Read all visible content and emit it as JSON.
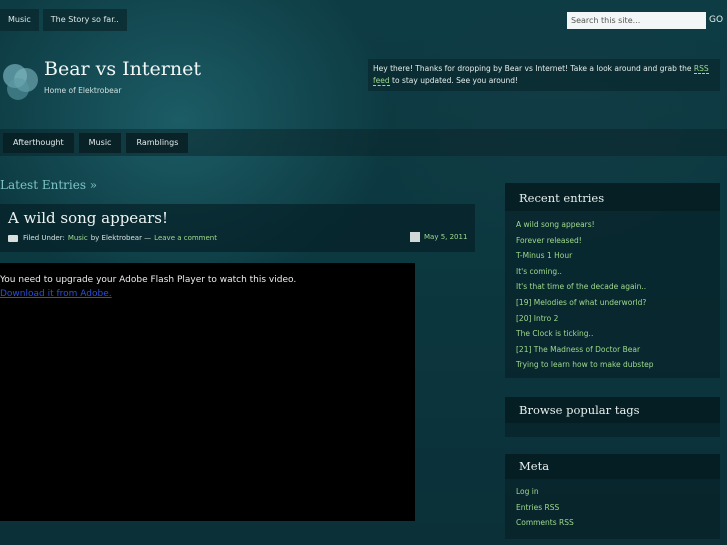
{
  "topnav": [
    "Music",
    "The Story so far.."
  ],
  "search": {
    "placeholder": "Search this site...",
    "go": "GO"
  },
  "site": {
    "title": "Bear vs Internet",
    "tagline": "Home of Elektrobear"
  },
  "welcome": {
    "text_before": "Hey there! Thanks for dropping by Bear vs Internet! Take a look around and grab the ",
    "rss_link": "RSS feed",
    "text_after": " to stay updated. See you around!"
  },
  "catnav": [
    "Afterthought",
    "Music",
    "Ramblings"
  ],
  "latest": "Latest Entries »",
  "post": {
    "title": "A wild song appears!",
    "filed_under": "Filed Under:",
    "category": "Music",
    "by": "by Elektrobear —",
    "comment": "Leave a comment",
    "date": "May 5, 2011",
    "flash_message": "You need to upgrade your Adobe Flash Player to watch this video.",
    "flash_link": "Download it from Adobe."
  },
  "sidebar": {
    "recent_title": "Recent entries",
    "recent": [
      "A wild song appears!",
      "Forever released!",
      "T-Minus 1 Hour",
      "It's coming..",
      "It's that time of the decade again..",
      "[19] Melodies of what underworld?",
      "[20] Intro 2",
      "The Clock is ticking..",
      "[21] The Madness of Doctor Bear",
      "Trying to learn how to make dubstep"
    ],
    "tags_title": "Browse popular tags",
    "meta_title": "Meta",
    "meta": [
      "Log in",
      "Entries RSS",
      "Comments RSS"
    ]
  },
  "colors": {
    "link_green": "#9fd98c",
    "accent_teal": "#7dc4c8"
  }
}
